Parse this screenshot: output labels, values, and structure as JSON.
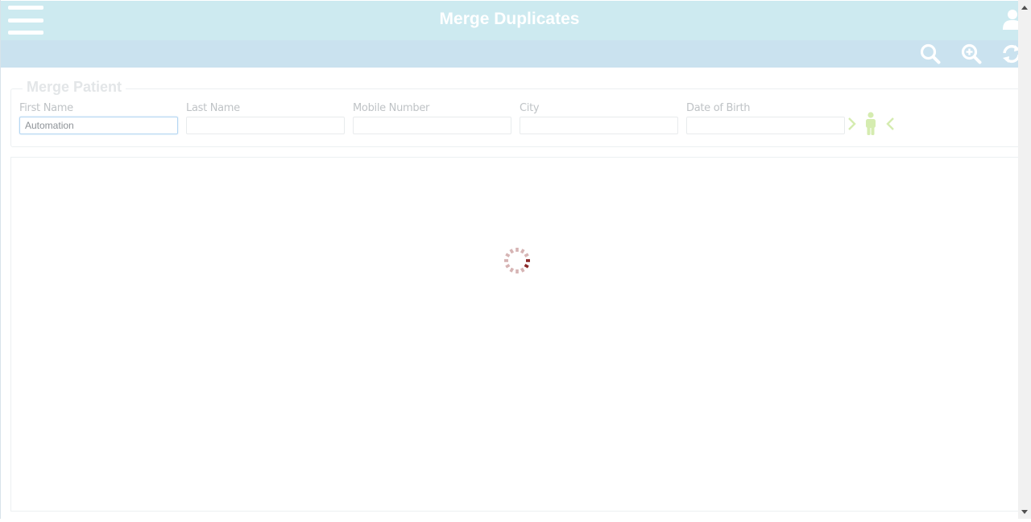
{
  "header": {
    "title": "Merge Duplicates",
    "menu_icon": "hamburger-menu-icon",
    "user_icon": "user-icon",
    "background": "#cdeaf0"
  },
  "toolbar": {
    "buttons": [
      {
        "icon": "search-icon"
      },
      {
        "icon": "zoom-in-icon"
      },
      {
        "icon": "refresh-icon"
      }
    ],
    "background": "#cae2ef"
  },
  "form": {
    "legend": "Merge Patient",
    "fields": [
      {
        "label": "First Name",
        "value": "Automation",
        "placeholder": ""
      },
      {
        "label": "Last Name",
        "value": "",
        "placeholder": ""
      },
      {
        "label": "Mobile Number",
        "value": "",
        "placeholder": ""
      },
      {
        "label": "City",
        "value": "",
        "placeholder": ""
      },
      {
        "label": "Date of Birth",
        "value": "",
        "placeholder": ""
      }
    ],
    "actions": [
      {
        "icon": "chevron-right-icon"
      },
      {
        "icon": "person-icon"
      },
      {
        "icon": "chevron-left-icon"
      }
    ],
    "accent": "#d5ecb0"
  },
  "results": {
    "loading": true,
    "spinner_icon": "loading-spinner-icon",
    "spinner_color": "#8b2a2a"
  }
}
